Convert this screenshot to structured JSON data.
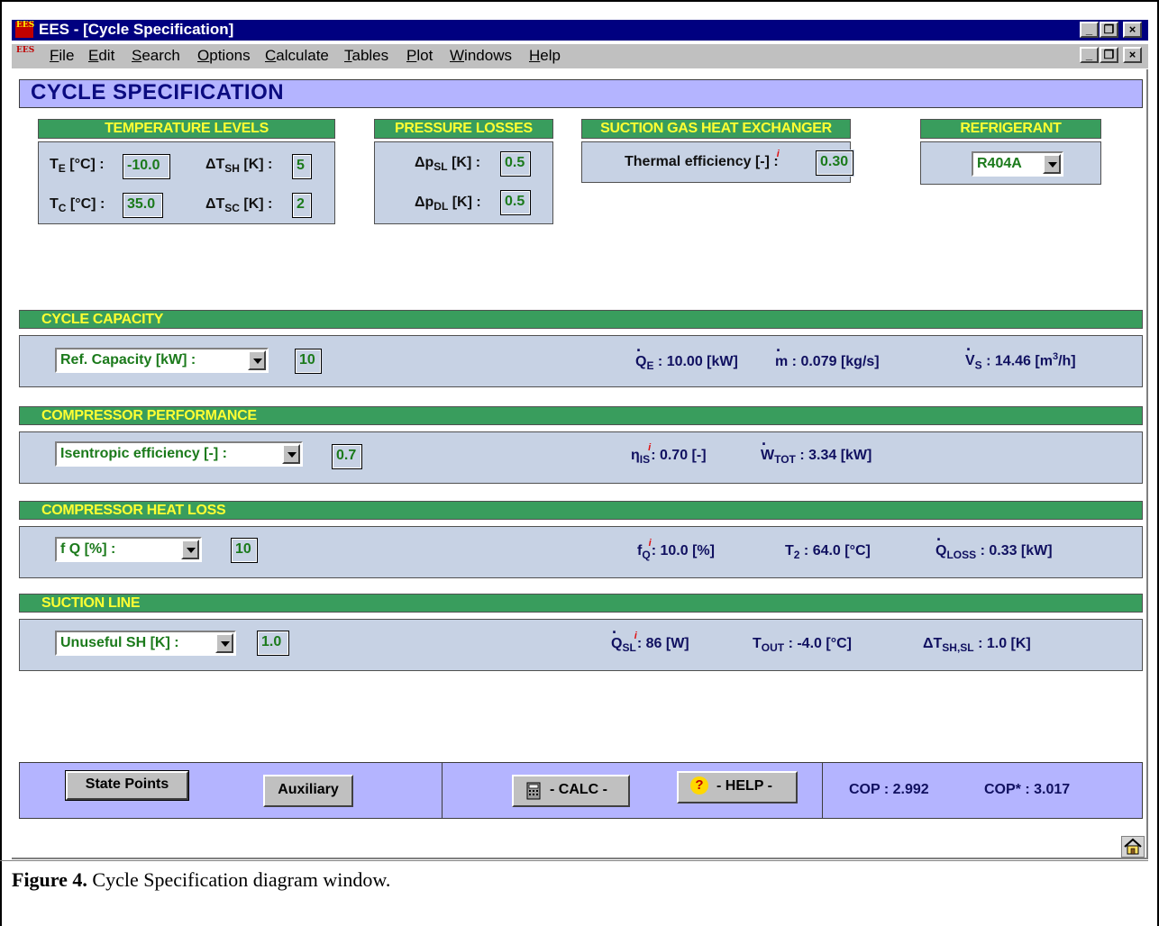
{
  "window": {
    "app_logo": "EES",
    "title": "EES - [Cycle Specification]",
    "title_controls": [
      "_",
      "❐",
      "×"
    ]
  },
  "menu": {
    "items": [
      "File",
      "Edit",
      "Search",
      "Options",
      "Calculate",
      "Tables",
      "Plot",
      "Windows",
      "Help"
    ],
    "controls": [
      "_",
      "❐",
      "×"
    ]
  },
  "banner": {
    "title": "CYCLE SPECIFICATION"
  },
  "temperature_levels": {
    "title": "TEMPERATURE LEVELS",
    "te_label": "T",
    "te_sub": "E",
    "te_unit": " [°C] :",
    "te_value": "-10.0",
    "dtsh_label": "ΔT",
    "dtsh_sub": "SH",
    "dtsh_unit": " [K] :",
    "dtsh_value": "5",
    "tc_label": "T",
    "tc_sub": "C",
    "tc_unit": " [°C] :",
    "tc_value": "35.0",
    "dtsc_label": "ΔT",
    "dtsc_sub": "SC",
    "dtsc_unit": " [K] :",
    "dtsc_value": "2"
  },
  "pressure_losses": {
    "title": "PRESSURE LOSSES",
    "psl_label": "Δp",
    "psl_sub": "SL",
    "psl_unit": " [K] :",
    "psl_value": "0.5",
    "pdl_label": "Δp",
    "pdl_sub": "DL",
    "pdl_unit": " [K] :",
    "pdl_value": "0.5"
  },
  "suction_hx": {
    "title": "SUCTION GAS HEAT EXCHANGER",
    "label": "Thermal efficiency [-] :",
    "info": "i",
    "value": "0.30"
  },
  "refrigerant": {
    "title": "REFRIGERANT",
    "selected": "R404A"
  },
  "cycle_capacity": {
    "title": "CYCLE CAPACITY",
    "selector": "Ref. Capacity [kW] :",
    "value": "10",
    "qe_label": "Q",
    "qe_sub": "E",
    "qe_value": " : 10.00 [kW]",
    "m_label": "m",
    "m_value": " : 0.079 [kg/s]",
    "vs_label": "V",
    "vs_sub": "S",
    "vs_value": " : 14.46 [m",
    "vs_sup": "3",
    "vs_tail": "/h]"
  },
  "compressor_performance": {
    "title": "COMPRESSOR PERFORMANCE",
    "selector": "Isentropic efficiency [-] :",
    "value": "0.7",
    "eta_label": "η",
    "eta_sub": "IS",
    "eta_info": "i",
    "eta_value": ": 0.70 [-]",
    "w_label": "W",
    "w_sub": "TOT",
    "w_value": " : 3.34 [kW]"
  },
  "compressor_heat_loss": {
    "title": "COMPRESSOR HEAT LOSS",
    "selector": "f Q [%] :",
    "value": "10",
    "fq_label": "f",
    "fq_sub": "Q",
    "fq_info": "i",
    "fq_value": ": 10.0 [%]",
    "t2_label": "T",
    "t2_sub": "2",
    "t2_value": " : 64.0 [°C]",
    "ql_label": "Q",
    "ql_sub": "LOSS",
    "ql_value": " : 0.33 [kW]"
  },
  "suction_line": {
    "title": "SUCTION LINE",
    "selector": "Unuseful SH [K] :",
    "value": "1.0",
    "qsl_label": "Q",
    "qsl_sub": "SL",
    "qsl_info": "i",
    "qsl_value": ": 86 [W]",
    "tout_label": "T",
    "tout_sub": "OUT",
    "tout_value": " : -4.0 [°C]",
    "dtsh_label": "ΔT",
    "dtsh_sub": "SH,SL",
    "dtsh_value": " : 1.0 [K]"
  },
  "footer": {
    "state_points": "State Points",
    "auxiliary": "Auxiliary",
    "calc": "- CALC -",
    "help": "- HELP -",
    "help_glyph": "?",
    "cop": "COP : 2.992",
    "cop_star": "COP* : 3.017"
  },
  "caption": {
    "label": "Figure 4.",
    "text": " Cycle Specification diagram window."
  }
}
